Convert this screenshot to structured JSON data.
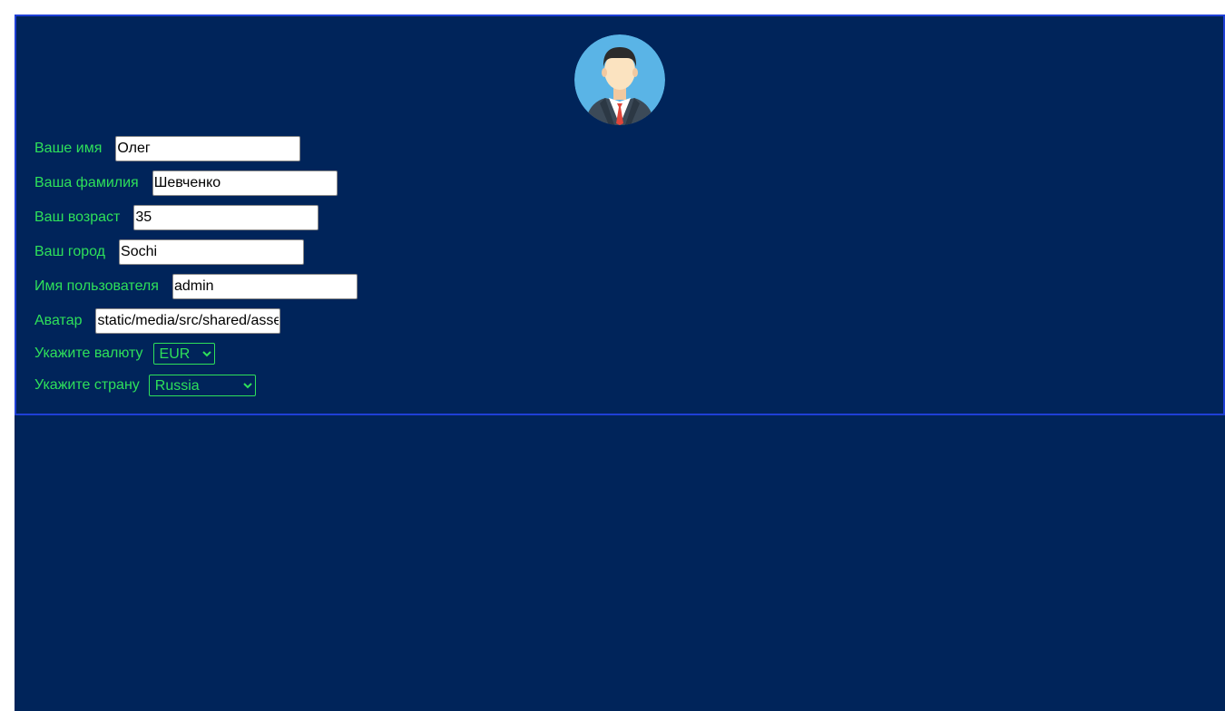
{
  "profile": {
    "avatar_icon": "user-avatar-businessman",
    "fields": [
      {
        "label": "Ваше имя",
        "value": "Олег"
      },
      {
        "label": "Ваша фамилия",
        "value": "Шевченко"
      },
      {
        "label": "Ваш возраст",
        "value": "35"
      },
      {
        "label": "Ваш город",
        "value": "Sochi"
      },
      {
        "label": "Имя пользователя",
        "value": "admin"
      },
      {
        "label": "Аватар",
        "value": "static/media/src/shared/assets"
      }
    ],
    "currency": {
      "label": "Укажите валюту",
      "selected": "EUR"
    },
    "country": {
      "label": "Укажите страну",
      "selected": "Russia"
    }
  },
  "colors": {
    "background": "#00245a",
    "border": "#1f3fd6",
    "label_text": "#2ee05a"
  }
}
